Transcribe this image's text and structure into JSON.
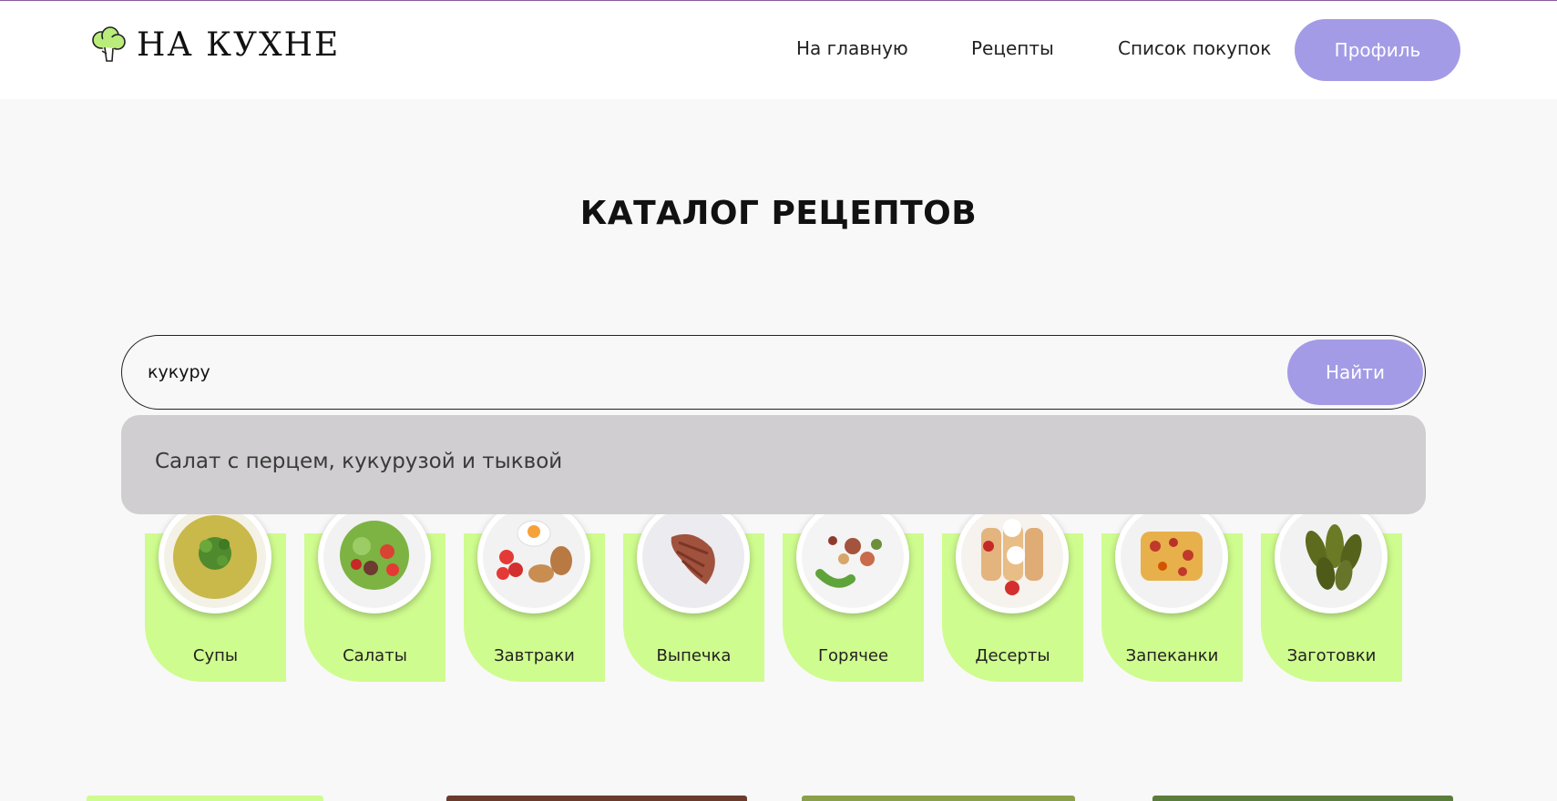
{
  "header": {
    "logo_text": "НА КУХНЕ",
    "nav": [
      {
        "label": "На главную"
      },
      {
        "label": "Рецепты"
      },
      {
        "label": "Список покупок"
      }
    ],
    "profile_label": "Профиль"
  },
  "main": {
    "title": "КАТАЛОГ РЕЦЕПТОВ",
    "search": {
      "value": "кукуру",
      "button_label": "Найти"
    },
    "suggestions": [
      {
        "label": "Салат с перцем, кукурузой и тыквой"
      }
    ],
    "categories": [
      {
        "label": "Супы",
        "icon": "soup-plate-image"
      },
      {
        "label": "Салаты",
        "icon": "salad-plate-image"
      },
      {
        "label": "Завтраки",
        "icon": "breakfast-plate-image"
      },
      {
        "label": "Выпечка",
        "icon": "pastry-plate-image"
      },
      {
        "label": "Горячее",
        "icon": "hot-dish-plate-image"
      },
      {
        "label": "Десерты",
        "icon": "dessert-plate-image"
      },
      {
        "label": "Запеканки",
        "icon": "casserole-plate-image"
      },
      {
        "label": "Заготовки",
        "icon": "pickles-plate-image"
      }
    ]
  },
  "colors": {
    "accent": "#a39be6",
    "category_bg": "#cffc8e",
    "dropdown_bg": "#d0ced0",
    "page_bg": "#f8f8f8"
  }
}
